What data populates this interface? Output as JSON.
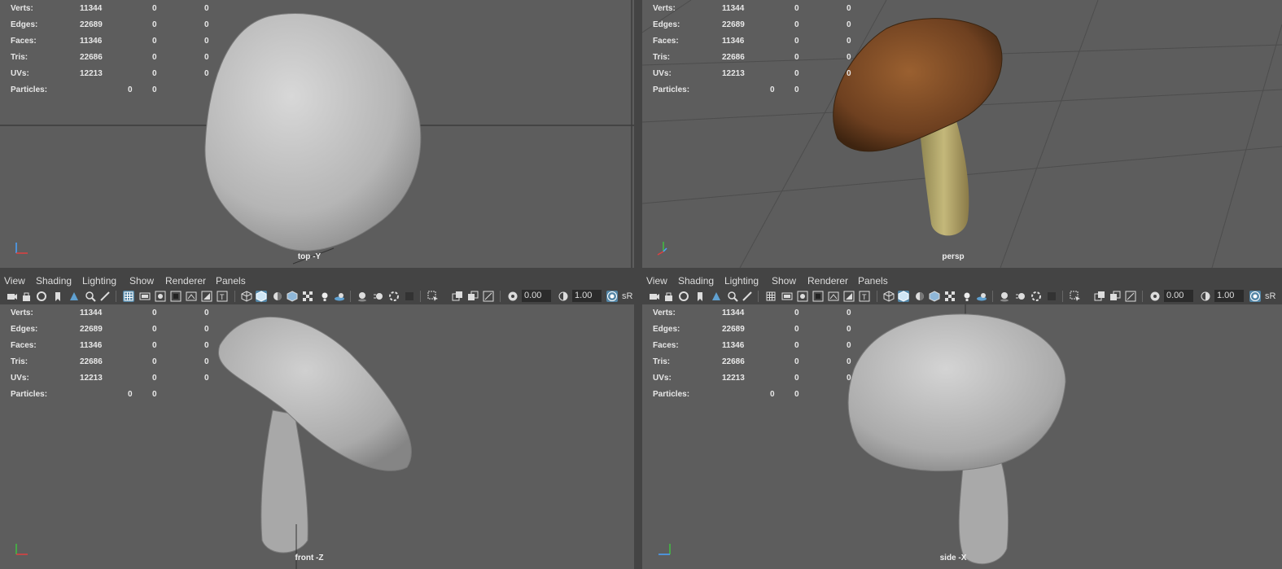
{
  "stats": {
    "rows": [
      {
        "label": "Verts:",
        "a": "11344",
        "b": "0",
        "c": "0"
      },
      {
        "label": "Edges:",
        "a": "22689",
        "b": "0",
        "c": "0"
      },
      {
        "label": "Faces:",
        "a": "11346",
        "b": "0",
        "c": "0"
      },
      {
        "label": "Tris:",
        "a": "22686",
        "b": "0",
        "c": "0"
      },
      {
        "label": "UVs:",
        "a": "12213",
        "b": "0",
        "c": "0"
      }
    ],
    "particles": {
      "label": "Particles:",
      "a": "0",
      "b": "0"
    }
  },
  "viewports": {
    "top": {
      "label": "top -Y"
    },
    "persp": {
      "label": "persp"
    },
    "front": {
      "label": "front -Z"
    },
    "side": {
      "label": "side -X"
    }
  },
  "menu": [
    "View",
    "Shading",
    "Lighting",
    "Show",
    "Renderer",
    "Panels"
  ],
  "toolbar": {
    "exposure": "0.00",
    "gamma": "1.00",
    "colorspace": "sR"
  },
  "colors": {
    "viewport_bg": "#5d5d5d",
    "grid": "#4a4a4a",
    "accent": "#5285a6",
    "mesh": "#b8b8b8",
    "cap": "#7a4a22",
    "stem": "#b8a86a"
  },
  "icons": [
    "camera-icon",
    "lock-camera-icon",
    "bookmark-icon",
    "image-plane-icon",
    "select-camera-icon",
    "grid-icon",
    "film-gate-icon",
    "resolution-gate-icon",
    "gate-mask-icon",
    "field-chart-icon",
    "safe-action-icon",
    "safe-title-icon",
    "wireframe-icon",
    "smooth-shade-icon",
    "flat-shade-icon",
    "bounding-box-icon",
    "textured-icon",
    "use-lights-icon",
    "shadows-icon",
    "screen-ao-icon",
    "motion-blur-icon",
    "anti-alias-icon",
    "depth-of-field-icon",
    "isolate-select-icon",
    "xray-icon",
    "xray-joints-icon",
    "backface-icon",
    "exposure-icon",
    "gamma-icon",
    "color-management-icon"
  ]
}
